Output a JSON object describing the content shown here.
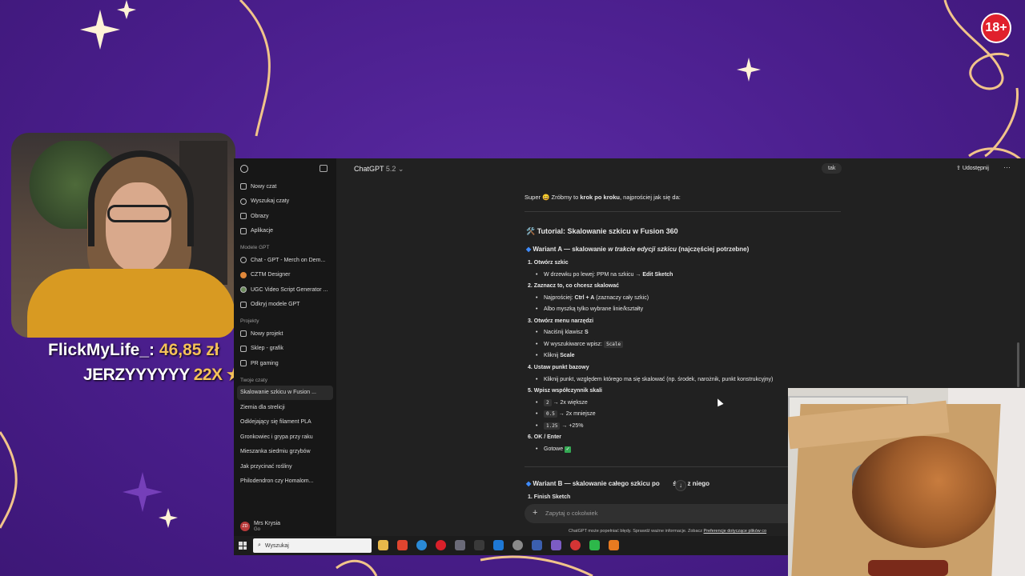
{
  "overlay": {
    "age_badge": "18+",
    "donation_line": {
      "user": "FlickMyLife_:",
      "amount": "46,85 zł"
    },
    "combo_line": {
      "user": "JERZYYYYYY",
      "multiplier": "22X",
      "star": "★"
    }
  },
  "app": {
    "model_name": "ChatGPT",
    "model_version": "5.2",
    "header_pill": "tak",
    "share_label": "Udostępnij",
    "more_label": "···"
  },
  "sidebar": {
    "top_items": [
      {
        "label": "Nowy czat",
        "icon": "edit-icon"
      },
      {
        "label": "Wyszukaj czaty",
        "icon": "search-icon"
      },
      {
        "label": "Obrazy",
        "icon": "image-icon"
      },
      {
        "label": "Aplikacje",
        "icon": "apps-icon"
      }
    ],
    "gpt_section": "Modele GPT",
    "gpts": [
      {
        "label": "Chat - GPT - Merch on Dem..."
      },
      {
        "label": "CZTM Designer"
      },
      {
        "label": "UGC Video Script Generator ..."
      },
      {
        "label": "Odkryj modele GPT"
      }
    ],
    "projects_section": "Projekty",
    "projects": [
      {
        "label": "Nowy projekt"
      },
      {
        "label": "Sklep - grafik"
      },
      {
        "label": "PR gaming"
      }
    ],
    "chats_section": "Twoje czaty",
    "chats": [
      {
        "label": "Skalowanie szkicu w Fusion ..."
      },
      {
        "label": "Ziemia dla strelicji"
      },
      {
        "label": "Odklejający się filament PLA"
      },
      {
        "label": "Gronkowiec i grypa przy raku"
      },
      {
        "label": "Mieszanka siedmiu grzybów"
      },
      {
        "label": "Jak przycinać rośliny"
      },
      {
        "label": "Philodendron czy Homalom..."
      }
    ],
    "user": {
      "initials": "ZD",
      "name": "Mrs Krysia",
      "plan": "Go"
    }
  },
  "message": {
    "intro_prefix": "Super 😄 Zróbmy to ",
    "intro_bold": "krok po kroku",
    "intro_suffix": ", najprościej jak się da:",
    "title": "🛠️ Tutorial: Skalowanie szkicu w Fusion 360",
    "variant_a": {
      "prefix": "Wariant A — skalowanie ",
      "italic": "w trakcie edycji szkicu",
      "suffix": " (najczęściej potrzebne)"
    },
    "steps": [
      {
        "num": "1.",
        "title": "Otwórz szkic"
      },
      {
        "num": "2.",
        "title": "Zaznacz to, co chcesz skalować"
      },
      {
        "num": "3.",
        "title": "Otwórz menu narzędzi"
      },
      {
        "num": "4.",
        "title": "Ustaw punkt bazowy"
      },
      {
        "num": "5.",
        "title": "Wpisz współczynnik skali"
      },
      {
        "num": "6.",
        "title": "OK / Enter"
      }
    ],
    "s1_b1_prefix": "W drzewku po lewej: PPM na szkicu → ",
    "s1_b1_bold": "Edit Sketch",
    "s2_b1_prefix": "Najprościej: ",
    "s2_b1_bold": "Ctrl + A",
    "s2_b1_suffix": " (zaznaczy cały szkic)",
    "s2_b2": "Albo myszką tylko wybrane linie/kształty",
    "s3_b1_prefix": "Naciśnij klawisz ",
    "s3_b1_bold": "S",
    "s3_b2_prefix": "W wyszukiwarce wpisz: ",
    "s3_b2_code": "Scale",
    "s3_b3_prefix": "Kliknij ",
    "s3_b3_bold": "Scale",
    "s4_b1": "Kliknij punkt, względem którego ma się skalować (np. środek, narożnik, punkt konstrukcyjny)",
    "s5_b1_code": "2",
    "s5_b1_text": " → 2x większe",
    "s5_b2_code": "0.5",
    "s5_b2_text": " → 2x mniejsze",
    "s5_b3_code": "1.25",
    "s5_b3_text": " → +25%",
    "s6_b1": "Gotowe ",
    "s6_check": "✓",
    "variant_b_prefix": "Wariant B — skalowanie całego szkicu po",
    "variant_b_suffix": "ściu z niego",
    "variant_b_step": {
      "num": "1.",
      "title": "Finish Sketch"
    }
  },
  "composer": {
    "placeholder": "Zapytaj o cokolwiek",
    "disclaimer": "ChatGPT może popełniać błędy. Sprawdź ważne informacje. Zobacz ",
    "disclaimer_link": "Preferencje dotyczące plików co"
  },
  "taskbar": {
    "search_placeholder": "Wyszukaj"
  }
}
